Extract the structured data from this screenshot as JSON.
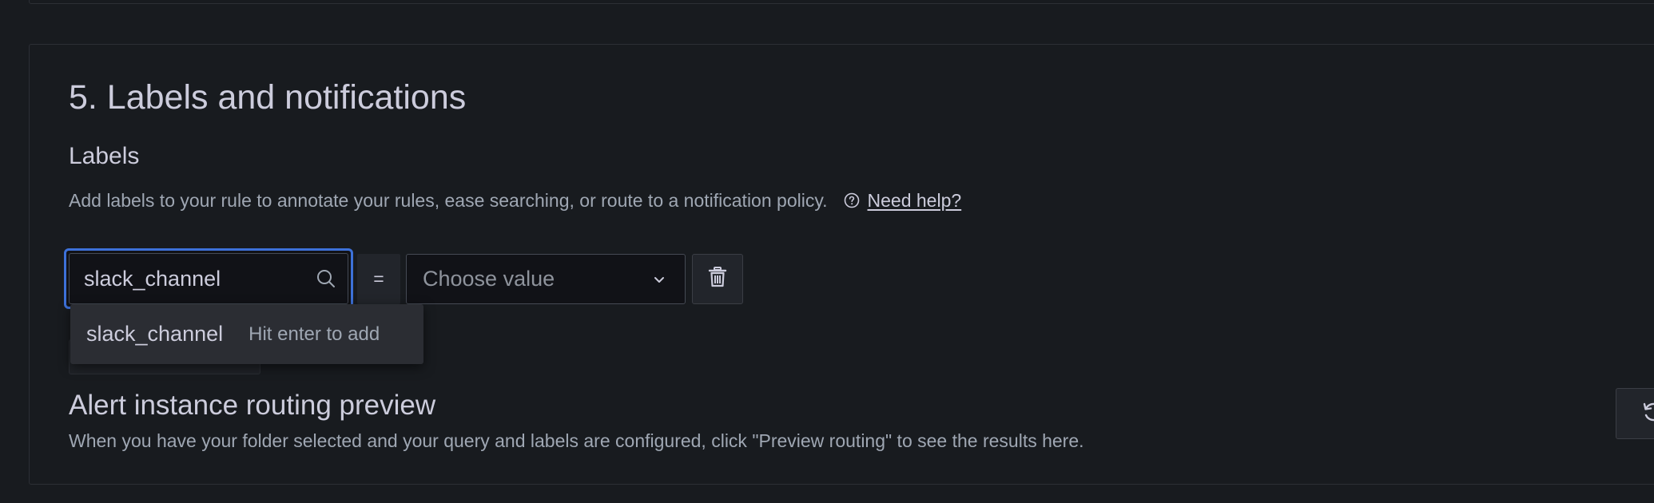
{
  "section": {
    "title": "5. Labels and notifications",
    "labels_heading": "Labels",
    "labels_description": "Add labels to your rule to annotate your rules, ease searching, or route to a notification policy.",
    "help_link": "Need help?"
  },
  "label_row": {
    "key_value": "slack_channel",
    "operator": "=",
    "value_placeholder": "Choose value"
  },
  "key_dropdown": {
    "option": "slack_channel",
    "hint": "Hit enter to add"
  },
  "routing_preview": {
    "title": "Alert instance routing preview",
    "description": "When you have your folder selected and your query and labels are configured, click \"Preview routing\" to see the results here."
  },
  "colors": {
    "background": "#181b1f",
    "panel_border": "#2c2f35",
    "text_primary": "#ccccdc",
    "text_secondary": "#9fa7b3",
    "focus_border": "#3d71d9",
    "input_bg": "#111217"
  },
  "icons": {
    "help": "question-circle-icon",
    "search": "search-icon",
    "chevron": "chevron-down-icon",
    "delete": "trash-icon",
    "refresh": "refresh-icon"
  }
}
